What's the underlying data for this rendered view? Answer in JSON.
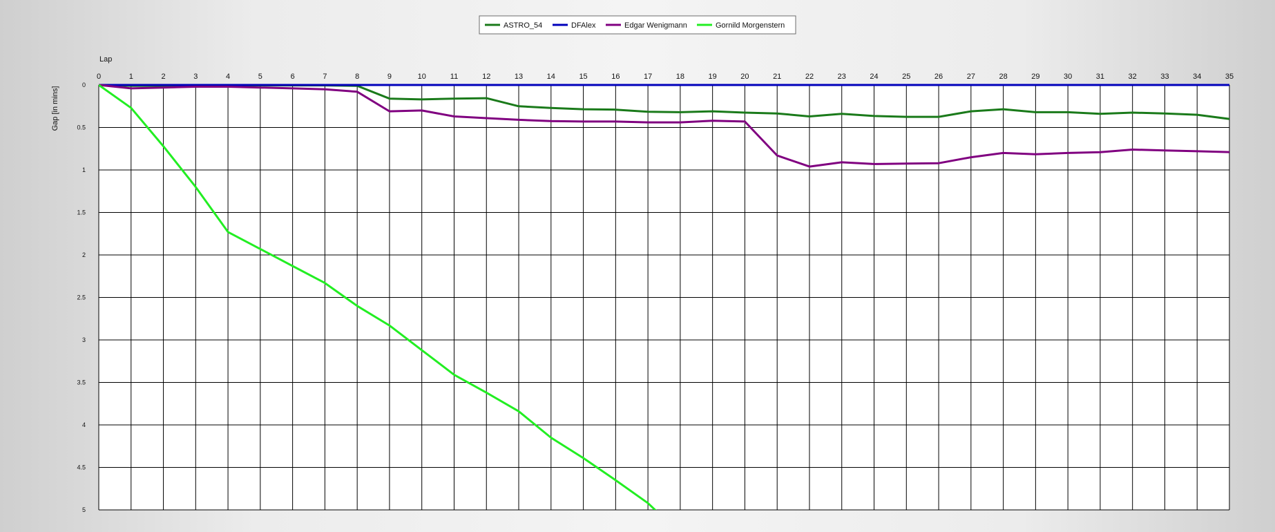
{
  "chart_data": {
    "type": "line",
    "xlabel": "Lap",
    "ylabel": "Gap [in mins]",
    "x": [
      0,
      1,
      2,
      3,
      4,
      5,
      6,
      7,
      8,
      9,
      10,
      11,
      12,
      13,
      14,
      15,
      16,
      17,
      18,
      19,
      20,
      21,
      22,
      23,
      24,
      25,
      26,
      27,
      28,
      29,
      30,
      31,
      32,
      33,
      34,
      35
    ],
    "xlim": [
      0,
      35
    ],
    "ylim": [
      0,
      5
    ],
    "y_inverted": true,
    "y_ticks": [
      "0",
      "0.5",
      "1",
      "1.5",
      "2",
      "2.5",
      "3",
      "3.5",
      "4",
      "4.5",
      "5"
    ],
    "grid": true,
    "legend_position": "top-center",
    "series": [
      {
        "name": "ASTRO_54",
        "color": "#1a7a1a",
        "values": [
          0,
          0.01,
          0.01,
          0.005,
          0.005,
          0.005,
          0.005,
          0.005,
          0.01,
          0.16,
          0.17,
          0.16,
          0.155,
          0.25,
          0.27,
          0.285,
          0.29,
          0.315,
          0.32,
          0.31,
          0.325,
          0.335,
          0.37,
          0.34,
          0.365,
          0.375,
          0.375,
          0.31,
          0.285,
          0.32,
          0.32,
          0.34,
          0.325,
          0.335,
          0.35,
          0.4
        ]
      },
      {
        "name": "DFAlex",
        "color": "#0000bb",
        "values": [
          0,
          0,
          0,
          0,
          0,
          0,
          0,
          0,
          0,
          0,
          0,
          0,
          0,
          0,
          0,
          0,
          0,
          0,
          0,
          0,
          0,
          0,
          0,
          0,
          0,
          0,
          0,
          0,
          0,
          0,
          0,
          0,
          0,
          0,
          0,
          0
        ]
      },
      {
        "name": "Edgar Wenigmann",
        "color": "#800080",
        "values": [
          0,
          0.04,
          0.03,
          0.02,
          0.02,
          0.03,
          0.04,
          0.05,
          0.08,
          0.31,
          0.3,
          0.37,
          0.39,
          0.41,
          0.425,
          0.43,
          0.43,
          0.44,
          0.44,
          0.42,
          0.43,
          0.83,
          0.96,
          0.91,
          0.93,
          0.925,
          0.92,
          0.85,
          0.8,
          0.815,
          0.8,
          0.79,
          0.76,
          0.77,
          0.78,
          0.79
        ]
      },
      {
        "name": "Gornild Morgenstern",
        "color": "#22ee22",
        "values": [
          0,
          0.27,
          0.72,
          1.2,
          1.73,
          1.93,
          2.13,
          2.33,
          2.6,
          2.83,
          3.12,
          3.41,
          3.62,
          3.84,
          4.15,
          4.39,
          4.65,
          4.92,
          5.28,
          null,
          null,
          null,
          null,
          null,
          null,
          null,
          null,
          null,
          null,
          null,
          null,
          null,
          null,
          null,
          null,
          null
        ]
      }
    ]
  }
}
